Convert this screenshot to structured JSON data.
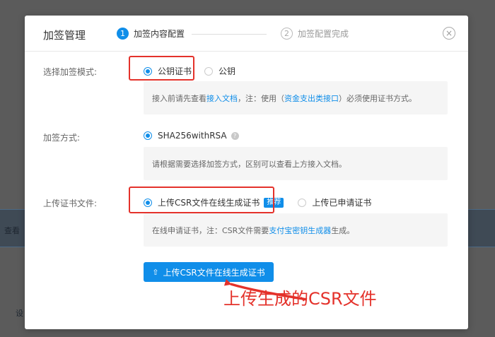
{
  "background": {
    "text_1": "查看",
    "text_2": "设"
  },
  "modal": {
    "title": "加签管理",
    "steps": [
      {
        "num": "1",
        "label": "加签内容配置"
      },
      {
        "num": "2",
        "label": "加签配置完成"
      }
    ],
    "close_icon": "×"
  },
  "mode": {
    "label": "选择加签模式:",
    "options": [
      "公钥证书",
      "公钥"
    ],
    "tip": {
      "prefix": "接入前请先查看",
      "link1": "接入文档",
      "middle": "，注：使用（",
      "link2": "资金支出类接口",
      "suffix": "）必须使用证书方式。"
    }
  },
  "method": {
    "label": "加签方式:",
    "option": "SHA256withRSA",
    "help_icon": "?",
    "tip": "请根据需要选择加签方式，区别可以查看上方接入文档。"
  },
  "upload": {
    "label": "上传证书文件:",
    "options": [
      "上传CSR文件在线生成证书",
      "上传已申请证书"
    ],
    "badge": "推荐",
    "tip": {
      "prefix": "在线申请证书，注：CSR文件需要",
      "link": "支付宝密钥生成器",
      "suffix": "生成。"
    },
    "button_label": "上传CSR文件在线生成证书",
    "button_icon": "⇧"
  },
  "annotation": {
    "text": "上传生成的CSR文件",
    "color": "#e4322b"
  },
  "colors": {
    "accent": "#108ee9",
    "annotation_red": "#e4322b"
  }
}
